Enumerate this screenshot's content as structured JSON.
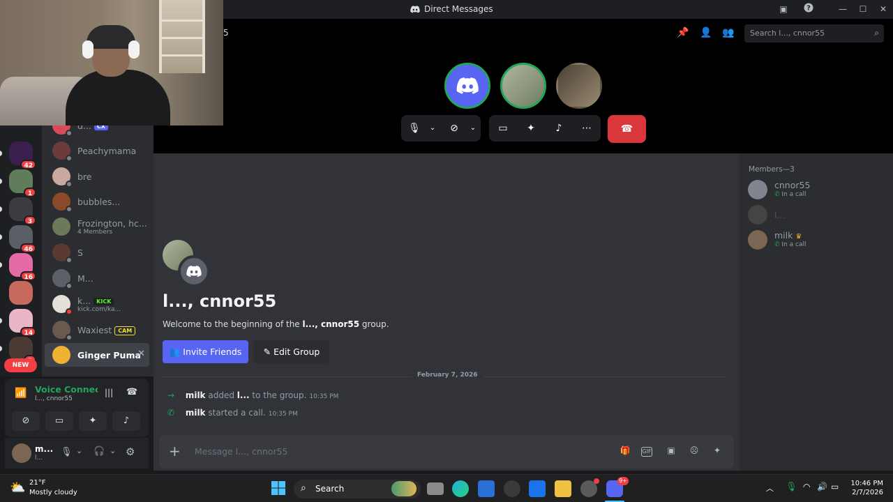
{
  "window": {
    "title": "Direct Messages",
    "channel_fragment": "5"
  },
  "search": {
    "placeholder": "Search l..., cnnor55"
  },
  "servers": [
    {
      "badge": "42",
      "color": "#3a1f4f"
    },
    {
      "badge": "1",
      "color": "#5f7d5a"
    },
    {
      "badge": "3",
      "color": "#3d3a40"
    },
    {
      "badge": "46",
      "color": "#5a5e66"
    },
    {
      "badge": "16",
      "color": "#e66aa8"
    },
    {
      "badge": "",
      "color": "#c96a5e"
    },
    {
      "badge": "14",
      "color": "#e8b6c5"
    },
    {
      "badge": "3",
      "color": "#4a3a33"
    }
  ],
  "new_badge": "NEW",
  "dms": [
    {
      "name": "d...",
      "tag": "CX",
      "sub": ""
    },
    {
      "name": "Peachymama",
      "sub": ""
    },
    {
      "name": "bre",
      "sub": ""
    },
    {
      "name": "bubbles...",
      "sub": ""
    },
    {
      "name": "Frozington, hc...",
      "sub": "4 Members"
    },
    {
      "name": "S",
      "sub": ""
    },
    {
      "name": "M...",
      "sub": ""
    },
    {
      "name": "k...",
      "tag": "KICK",
      "sub": "kick.com/ka..."
    },
    {
      "name": "Waxiest",
      "tag": "CAM",
      "sub": ""
    },
    {
      "name": "Ginger Puma",
      "sub": "",
      "active": true
    }
  ],
  "voice": {
    "status": "Voice Connected",
    "channel": "l..., cnnor55"
  },
  "user": {
    "name": "m...",
    "sub": "l..."
  },
  "call": {
    "end_label": "end-call"
  },
  "members_header": "Members—3",
  "members": [
    {
      "name": "cnnor55",
      "sub": "In a call"
    },
    {
      "name": "l...",
      "sub": ""
    },
    {
      "name": "milk",
      "sub": "In a call"
    }
  ],
  "chat": {
    "title": "l..., cnnor55",
    "welcome_prefix": "Welcome to the beginning of the ",
    "welcome_group": "l..., cnnor55",
    "welcome_suffix": " group.",
    "invite_label": "Invite Friends",
    "edit_label": "Edit Group",
    "date": "February 7, 2026",
    "messages": [
      {
        "actor": "milk",
        "text1": " added ",
        "target": "l...",
        "text2": " to the group.",
        "time": "10:35 PM"
      },
      {
        "actor": "milk",
        "text1": " started a call.",
        "target": "",
        "text2": "",
        "time": "10:35 PM"
      }
    ],
    "composer_placeholder": "Message l..., cnnor55"
  },
  "taskbar": {
    "temp": "21°F",
    "condition": "Mostly cloudy",
    "search_label": "Search",
    "time": "10:46 PM",
    "date": "2/7/2026",
    "discord_badge": "9+"
  }
}
